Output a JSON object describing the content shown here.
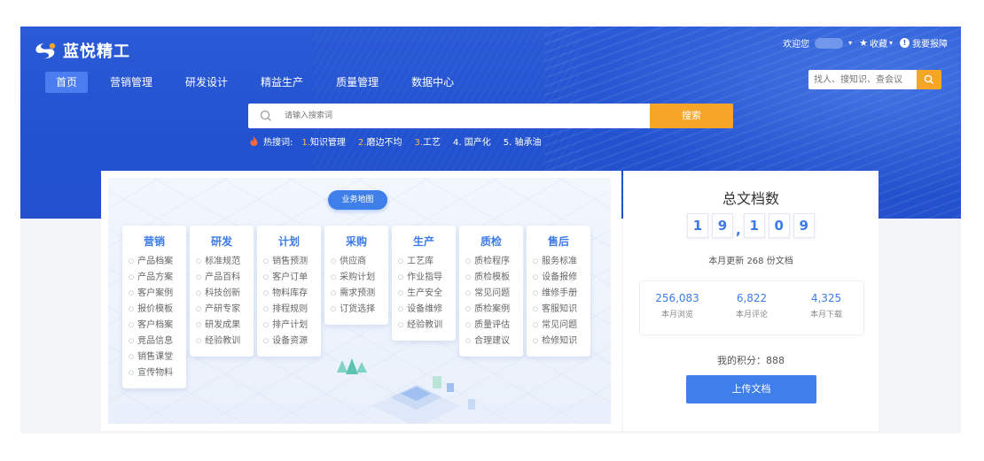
{
  "brand": {
    "name": "蓝悦精工"
  },
  "topbar": {
    "welcome": "欢迎您",
    "favorites": "收藏",
    "report": "我要报障"
  },
  "nav": {
    "items": [
      "首页",
      "营销管理",
      "研发设计",
      "精益生产",
      "质量管理",
      "数据中心"
    ],
    "active": "首页"
  },
  "small_search": {
    "placeholder": "找人、搜知识、查会议"
  },
  "search": {
    "placeholder": "请输入搜索词",
    "button": "搜索"
  },
  "hot": {
    "label": "热搜词:",
    "items": [
      {
        "num": "1.",
        "text": "知识管理"
      },
      {
        "num": "2.",
        "text": "磨边不均"
      },
      {
        "num": "3.",
        "text": "工艺"
      },
      {
        "num": "4.",
        "text": "国产化"
      },
      {
        "num": "5.",
        "text": "轴承油"
      }
    ]
  },
  "business_map": {
    "tag": "业务地图",
    "categories": [
      {
        "title": "营销",
        "items": [
          "产品档案",
          "产品方案",
          "客户案例",
          "报价模板",
          "客户档案",
          "竞品信息",
          "销售课堂",
          "宣传物料"
        ]
      },
      {
        "title": "研发",
        "items": [
          "标准规范",
          "产品百科",
          "科技创新",
          "产研专家",
          "研发成果",
          "经验教训"
        ]
      },
      {
        "title": "计划",
        "items": [
          "销售预测",
          "客户订单",
          "物料库存",
          "排程规则",
          "排产计划",
          "设备资源"
        ]
      },
      {
        "title": "采购",
        "items": [
          "供应商",
          "采购计划",
          "需求预测",
          "订货选择"
        ]
      },
      {
        "title": "生产",
        "items": [
          "工艺库",
          "作业指导",
          "生产安全",
          "设备维修",
          "经验教训"
        ]
      },
      {
        "title": "质检",
        "items": [
          "质检程序",
          "质检模板",
          "常见问题",
          "质检案例",
          "质量评估",
          "合理建议"
        ]
      },
      {
        "title": "售后",
        "items": [
          "服务标准",
          "设备报修",
          "维修手册",
          "客服知识",
          "常见问题",
          "检修知识"
        ]
      }
    ]
  },
  "docs": {
    "title": "总文档数",
    "digits": [
      "1",
      "9",
      "1",
      "0",
      "9"
    ],
    "month_update": "本月更新 268 份文档",
    "stats": [
      {
        "value": "256,083",
        "label": "本月浏览"
      },
      {
        "value": "6,822",
        "label": "本月评论"
      },
      {
        "value": "4,325",
        "label": "本月下载"
      }
    ],
    "score": "我的积分：888",
    "upload": "上传文档"
  },
  "colors": {
    "hero_blue": "#2252cf",
    "accent_orange": "#f7a528",
    "primary_blue": "#3f7fe9"
  }
}
